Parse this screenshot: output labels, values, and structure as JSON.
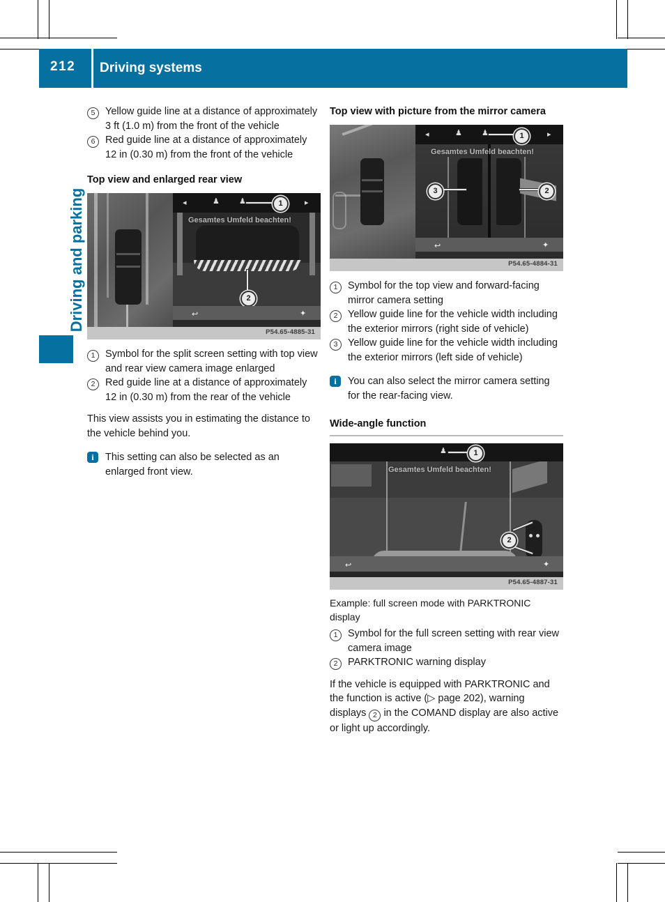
{
  "header": {
    "page_number": "212",
    "title": "Driving systems",
    "accent_color": "#0670a0"
  },
  "chapter_tab": {
    "label": "Driving and parking"
  },
  "left_column": {
    "legend_top": [
      {
        "marker": "5",
        "text": "Yellow guide line at a distance of approximately 3 ft (1.0 m) from the front of the vehicle"
      },
      {
        "marker": "6",
        "text": "Red guide line at a distance of approximately 12 in (0.30 m) from the front of the vehicle"
      }
    ],
    "heading": "Top view and enlarged rear view",
    "figure": {
      "code": "P54.65-4885-31",
      "screen_text": "Gesamtes Umfeld beachten!",
      "callouts": [
        "1",
        "2"
      ]
    },
    "legend_bottom": [
      {
        "marker": "1",
        "text": "Symbol for the split screen setting with top view and rear view camera image enlarged"
      },
      {
        "marker": "2",
        "text": "Red guide line at a distance of approximately 12 in (0.30 m) from the rear of the vehicle"
      }
    ],
    "paragraph": "This view assists you in estimating the distance to the vehicle behind you.",
    "note": "This setting can also be selected as an enlarged front view."
  },
  "right_column": {
    "heading_1": "Top view with picture from the mirror camera",
    "figure_1": {
      "code": "P54.65-4884-31",
      "screen_text": "Gesamtes Umfeld beachten!",
      "callouts": [
        "1",
        "2",
        "3"
      ]
    },
    "legend_1": [
      {
        "marker": "1",
        "text": "Symbol for the top view and forward-facing mirror camera setting"
      },
      {
        "marker": "2",
        "text": "Yellow guide line for the vehicle width including the exterior mirrors (right side of vehicle)"
      },
      {
        "marker": "3",
        "text": "Yellow guide line for the vehicle width including the exterior mirrors (left side of vehicle)"
      }
    ],
    "note_1": "You can also select the mirror camera setting for the rear-facing view.",
    "heading_2": "Wide-angle function",
    "figure_2": {
      "code": "P54.65-4887-31",
      "screen_text": "Gesamtes Umfeld beachten!",
      "callouts": [
        "1",
        "2"
      ]
    },
    "caption_2": "Example: full screen mode with PARKTRONIC display",
    "legend_2": [
      {
        "marker": "1",
        "text": "Symbol for the full screen setting with rear view camera image"
      },
      {
        "marker": "2",
        "text": "PARKTRONIC warning display"
      }
    ],
    "closing_paragraph_part1": "If the vehicle is equipped with PARKTRONIC and the function is active (▷ page 202), warning displays",
    "closing_marker": "2",
    "closing_paragraph_part2": "in the COMAND display are also active or light up accordingly."
  }
}
